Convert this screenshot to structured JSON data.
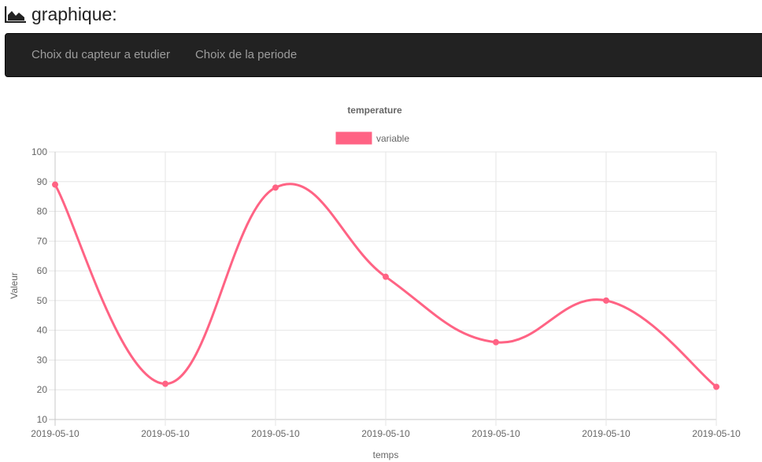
{
  "header": {
    "title": "graphique:",
    "icon": "area-chart-icon"
  },
  "nav": {
    "items": [
      {
        "label": "Choix du capteur a etudier"
      },
      {
        "label": "Choix de la periode"
      }
    ]
  },
  "colors": {
    "navbar_bg": "#222222",
    "nav_text": "#9d9d9d",
    "series_line": "#ff6384",
    "grid": "#e6e6e6",
    "text": "#666666"
  },
  "chart_data": {
    "type": "line",
    "title": "temperature",
    "xlabel": "temps",
    "ylabel": "Valeur",
    "categories": [
      "2019-05-10",
      "2019-05-10",
      "2019-05-10",
      "2019-05-10",
      "2019-05-10",
      "2019-05-10",
      "2019-05-10"
    ],
    "series": [
      {
        "name": "variable",
        "values": [
          89,
          22,
          88,
          58,
          36,
          50,
          21
        ]
      }
    ],
    "ylim": [
      10,
      100
    ],
    "yticks": [
      100,
      90,
      80,
      70,
      60,
      50,
      40,
      30,
      20,
      10
    ],
    "grid": true,
    "legend": "top-center",
    "smooth": true
  }
}
